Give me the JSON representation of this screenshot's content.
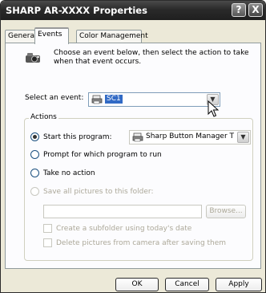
{
  "window": {
    "title": "SHARP AR-XXXX Properties"
  },
  "title_buttons": {
    "help": "?",
    "close": "X"
  },
  "tabs": [
    {
      "label": "General"
    },
    {
      "label": "Events",
      "active": true
    },
    {
      "label": "Color Management"
    }
  ],
  "events": {
    "description": "Choose an event below, then select the action to take when that event occurs.",
    "select_label": "Select an event:",
    "selected_event": "SC1"
  },
  "actions": {
    "group_label": "Actions",
    "start_program_label": "Start this program:",
    "program_value": "Sharp Button Manager T",
    "prompt_label": "Prompt for which program to run",
    "no_action_label": "Take no action",
    "save_label": "Save all pictures to this folder:",
    "folder_value": "",
    "browse_label": "Browse...",
    "subfolder_label": "Create a subfolder using today's date",
    "delete_label": "Delete pictures from camera after saving them"
  },
  "footer": {
    "ok": "OK",
    "cancel": "Cancel",
    "apply": "Apply"
  },
  "colors": {
    "titlebar": "#2a2a2a",
    "selection": "#316ac5",
    "dialog": "#ece9d8"
  }
}
